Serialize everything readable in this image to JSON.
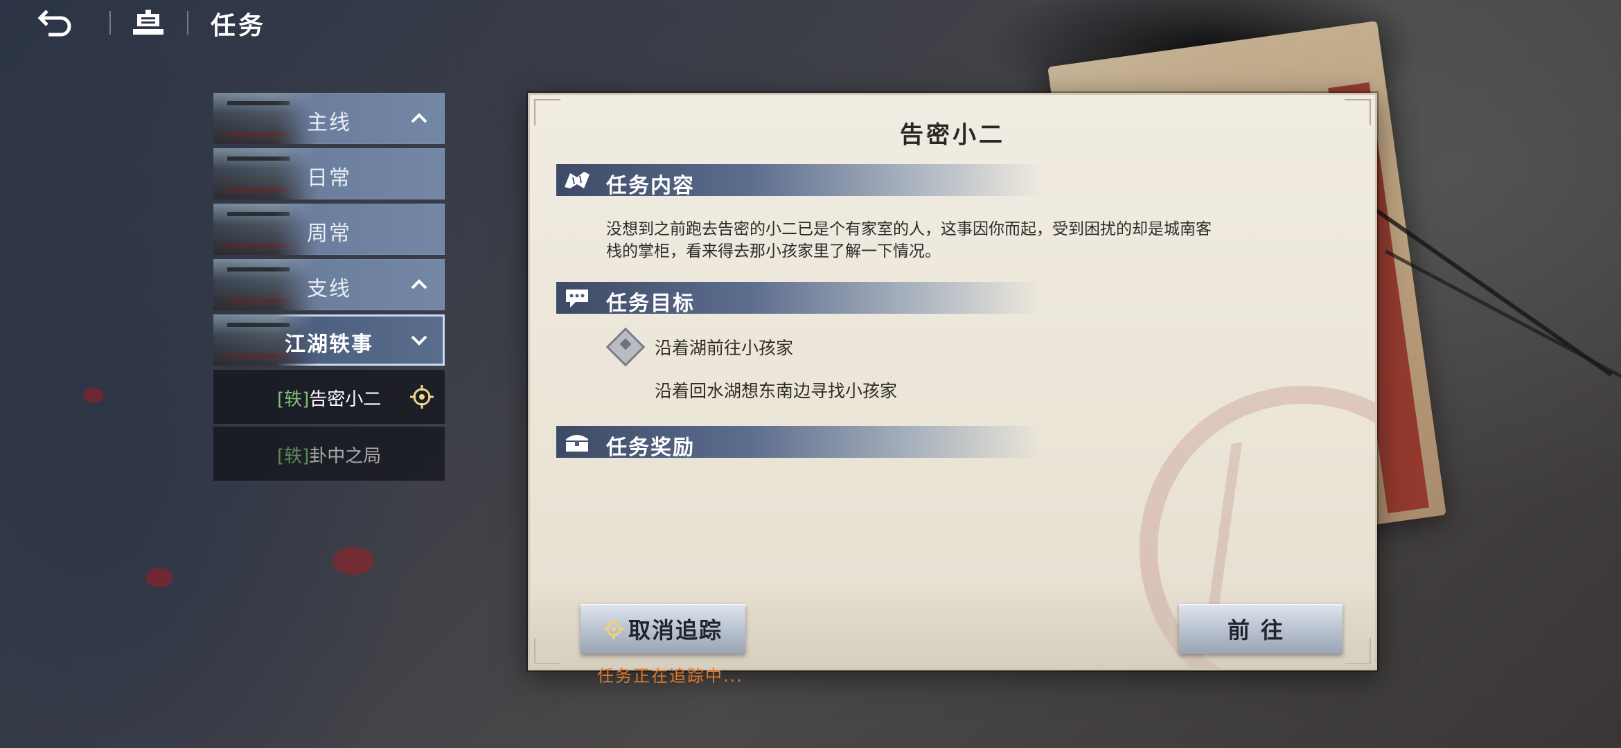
{
  "topbar": {
    "title": "任务"
  },
  "sidebar": {
    "categories": [
      {
        "label": "主线",
        "expanded": true
      },
      {
        "label": "日常"
      },
      {
        "label": "周常"
      },
      {
        "label": "支线",
        "expanded": true
      },
      {
        "label": "江湖轶事",
        "expanded": true,
        "selected": true
      }
    ],
    "quests": [
      {
        "tag": "[轶]",
        "name": "告密小二",
        "active": true
      },
      {
        "tag": "[轶]",
        "name": "卦中之局",
        "active": false
      }
    ]
  },
  "panel": {
    "title": "告密小二",
    "sections": {
      "content": "任务内容",
      "objective": "任务目标",
      "reward": "任务奖励"
    },
    "description_line1": "没想到之前跑去告密的小二已是个有家室的人，这事因你而起，受到困扰的却是城南客",
    "description_line2": "栈的掌柜，看来得去那小孩家里了解一下情况。",
    "objective_main": "沿着湖前往小孩家",
    "objective_sub": "沿着回水湖想东南边寻找小孩家"
  },
  "buttons": {
    "untrack": "取消追踪",
    "go": "前往"
  },
  "tracking_note": "任务正在追踪中...",
  "colors": {
    "accent_blue": "#5d6d8e",
    "tracking_orange": "#e07a2e",
    "tag_green": "#7fbf7a"
  }
}
